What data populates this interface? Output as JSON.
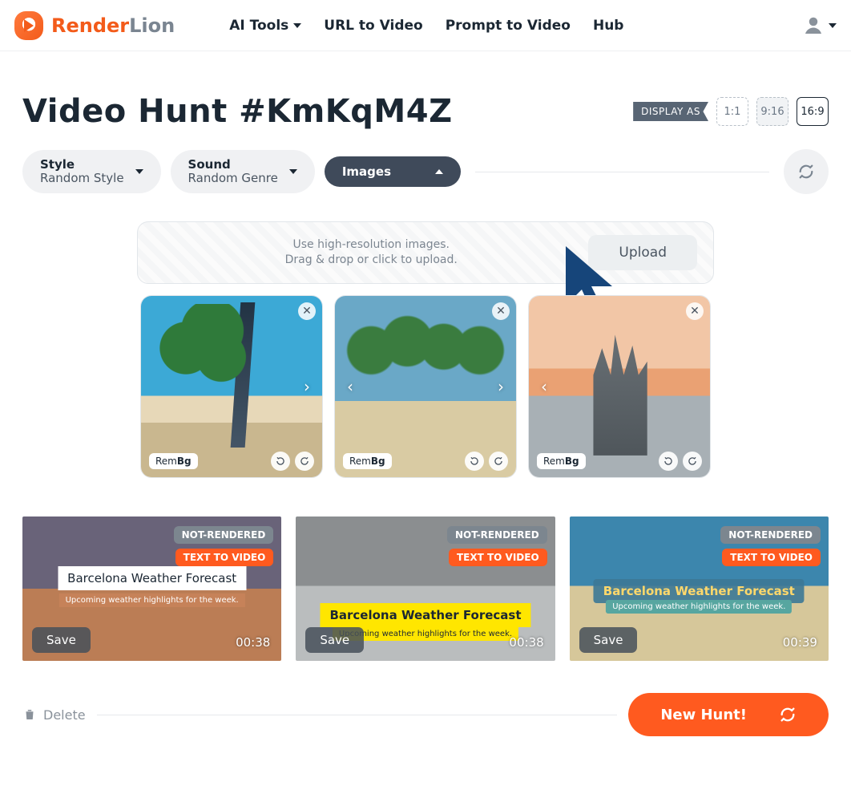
{
  "brand": {
    "word1": "Render",
    "word2": "Lion"
  },
  "nav": {
    "ai_tools": "AI Tools",
    "url_to_video": "URL to Video",
    "prompt_to_video": "Prompt to Video",
    "hub": "Hub"
  },
  "page": {
    "title": "Video Hunt #KmKqM4Z",
    "display_as_label": "DISPLAY AS",
    "ratios": {
      "r1": "1:1",
      "r2": "9:16",
      "r3": "16:9",
      "active": "16:9"
    }
  },
  "controls": {
    "style": {
      "label": "Style",
      "value": "Random Style"
    },
    "sound": {
      "label": "Sound",
      "value": "Random Genre"
    },
    "images": {
      "label": "Images"
    }
  },
  "uploader": {
    "line1": "Use high-resolution images.",
    "line2": "Drag & drop or click to upload.",
    "button": "Upload"
  },
  "thumbs": {
    "rembg": "Rem",
    "rembg_bold": "Bg"
  },
  "results": [
    {
      "status": "NOT-RENDERED",
      "type": "TEXT TO VIDEO",
      "title": "Barcelona Weather Forecast",
      "subtitle": "Upcoming weather highlights for the week.",
      "save": "Save",
      "duration": "00:38"
    },
    {
      "status": "NOT-RENDERED",
      "type": "TEXT TO VIDEO",
      "title": "Barcelona Weather Forecast",
      "subtitle": "Upcoming weather highlights for the week.",
      "save": "Save",
      "duration": "00:38"
    },
    {
      "status": "NOT-RENDERED",
      "type": "TEXT TO VIDEO",
      "title": "Barcelona Weather Forecast",
      "subtitle": "Upcoming weather highlights for the week.",
      "save": "Save",
      "duration": "00:39"
    }
  ],
  "footer": {
    "delete": "Delete",
    "new_hunt": "New Hunt!"
  }
}
